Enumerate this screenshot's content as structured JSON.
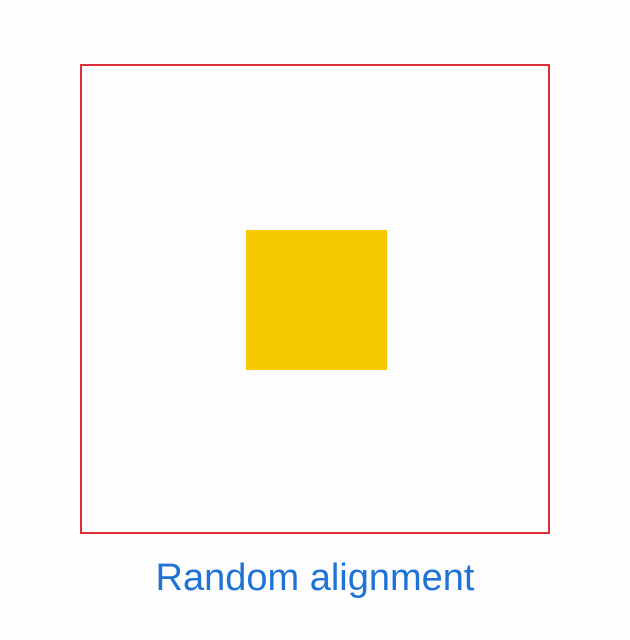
{
  "action": {
    "label": "Random alignment"
  },
  "colors": {
    "frame_border": "#dc2f3a",
    "square_fill": "#f5c800",
    "action_text": "#1f73d6",
    "background": "#fdfdfd"
  }
}
